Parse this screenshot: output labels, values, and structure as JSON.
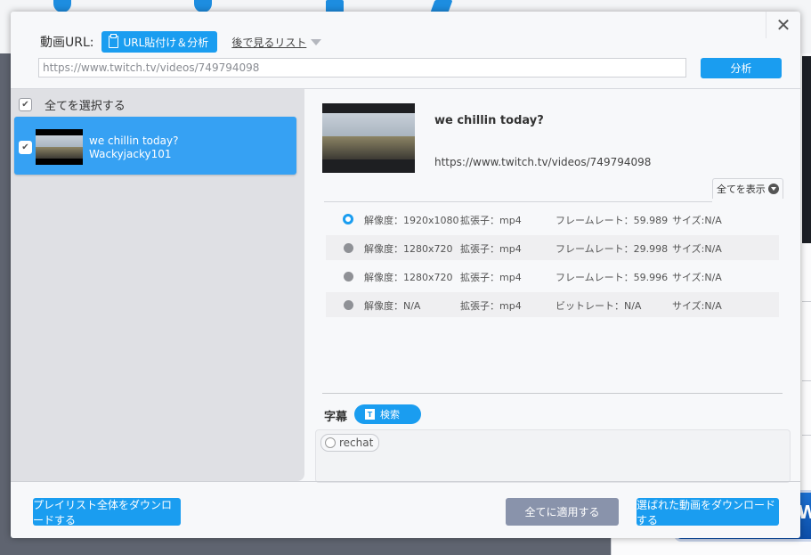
{
  "dialog": {
    "close_icon": "close-icon",
    "url_label": "動画URL:",
    "paste_button": "URL貼付け＆分析",
    "later_list": "後で見るリスト",
    "url_value": "https://www.twitch.tv/videos/749794098",
    "analyze_button": "分析"
  },
  "left_pane": {
    "select_all_label": "全てを選択する",
    "select_all_checked": true,
    "items": [
      {
        "title": "we chillin today?",
        "channel": "Wackyjacky101",
        "checked": true,
        "selected": true
      }
    ]
  },
  "detail": {
    "title": "we chillin today?",
    "url": "https://www.twitch.tv/videos/749794098",
    "show_all": "全てを表示",
    "formats": [
      {
        "selected": true,
        "res": "解像度：1920x1080",
        "ext": "拡張子：mp4",
        "rate": "フレームレート：59.989",
        "size": "サイズ:N/A"
      },
      {
        "selected": false,
        "res": "解像度：1280x720",
        "ext": "拡張子：mp4",
        "rate": "フレームレート：29.998",
        "size": "サイズ:N/A"
      },
      {
        "selected": false,
        "res": "解像度：1280x720",
        "ext": "拡張子：mp4",
        "rate": "フレームレート：59.996",
        "size": "サイズ:N/A"
      },
      {
        "selected": false,
        "res": "解像度：N/A",
        "ext": "拡張子：mp4",
        "rate": "ビットレート：N/A",
        "size": "サイズ:N/A"
      }
    ],
    "subtitles_label": "字幕",
    "subtitle_search": "検索",
    "subtitle_options": [
      "rechat"
    ]
  },
  "footer": {
    "playlist_button": "プレイリスト全体をダウンロードする",
    "apply_all_button": "全てに適用する",
    "download_selected_button": "選ばれた動画をダウンロードする"
  },
  "colors": {
    "accent": "#1a9df0",
    "selected_item": "#36a1f3",
    "apply_button": "#8993ab"
  }
}
